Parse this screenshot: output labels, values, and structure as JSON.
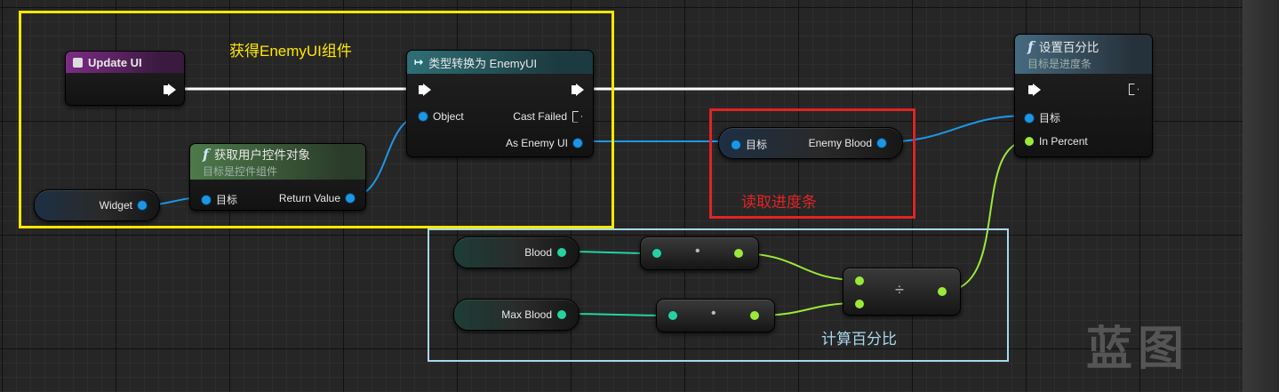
{
  "nodes": {
    "update_ui": {
      "title": "Update UI"
    },
    "get_widget": {
      "title": "获取用户控件对象",
      "subtitle": "目标是控件组件",
      "target_pin": "目标",
      "return_pin": "Return Value",
      "func_symbol": "f"
    },
    "cast": {
      "title": "类型转换为 EnemyUI",
      "object_pin": "Object",
      "cast_failed_pin": "Cast Failed",
      "as_pin": "As Enemy UI"
    },
    "set_percent": {
      "title": "设置百分比",
      "subtitle": "目标是进度条",
      "target_pin": "目标",
      "percent_pin": "In Percent",
      "func_symbol": "f"
    },
    "enemy_blood": {
      "target_pin": "目标",
      "output_pin": "Enemy Blood"
    },
    "widget_var": {
      "label": "Widget"
    },
    "blood_var": {
      "label": "Blood"
    },
    "max_blood_var": {
      "label": "Max Blood"
    },
    "convert1": {
      "symbol": "•"
    },
    "convert2": {
      "symbol": "•"
    },
    "divide": {
      "symbol": "÷"
    }
  },
  "comments": {
    "yellow": {
      "label": "获得EnemyUI组件",
      "color": "#ffe800"
    },
    "red": {
      "label": "读取进度条",
      "color": "#e02424"
    },
    "cyan": {
      "label": "计算百分比",
      "color": "#a8d8ee"
    }
  },
  "watermark": "蓝图",
  "colors": {
    "exec": "#ffffff",
    "object_pin": "#1e96e6",
    "float_pin": "#9be83a",
    "int_pin": "#25d3a2"
  }
}
